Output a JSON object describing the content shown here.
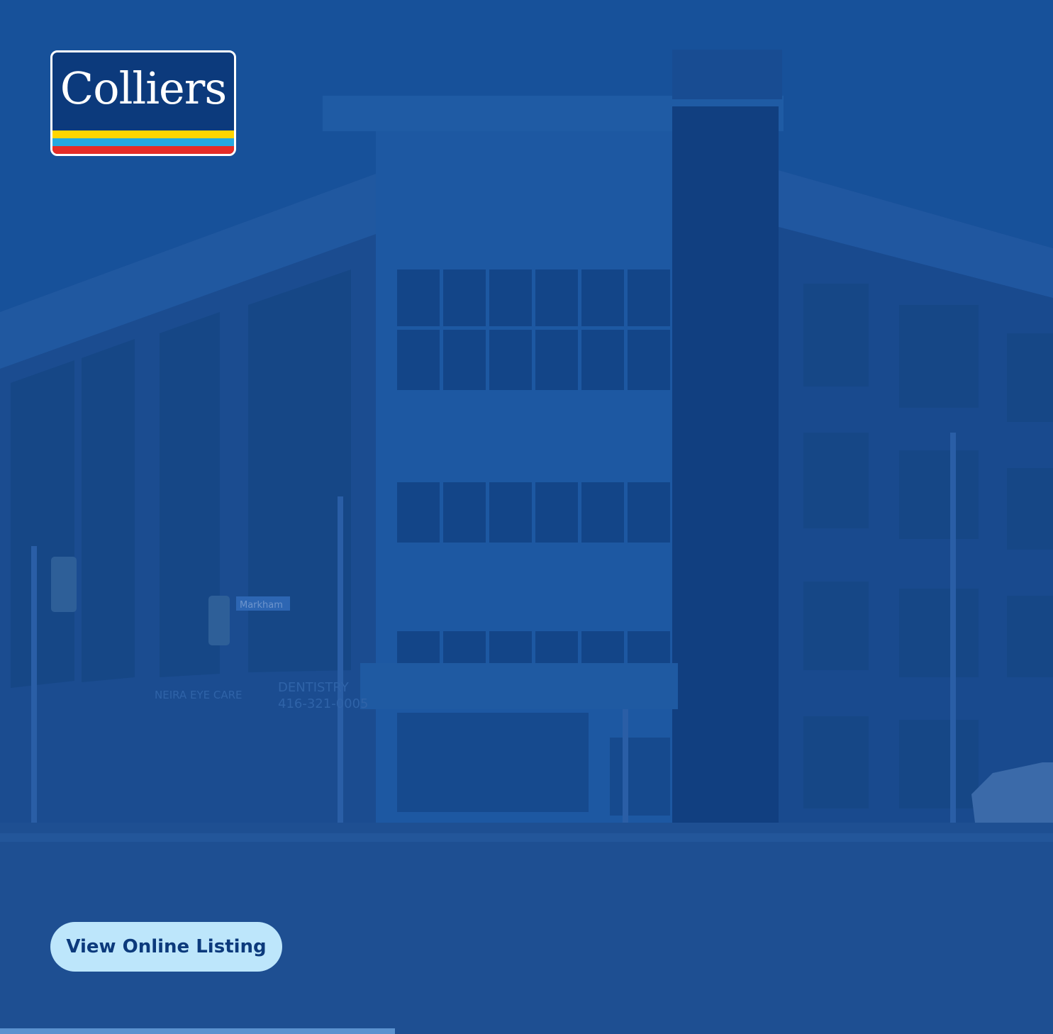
{
  "logo": {
    "text": "Colliers",
    "colors": {
      "background": "#0c3a7c",
      "yellow": "#ffd500",
      "blue": "#25a9e0",
      "red": "#e52d27"
    }
  },
  "background_photo": {
    "signs": {
      "street": "Markham",
      "eye_care": "NEIRA EYE CARE",
      "dentistry": "DENTISTRY",
      "phone": "416-321-0005"
    }
  },
  "cta": {
    "label": "View Online Listing"
  },
  "progress": {
    "fraction": 0.375
  },
  "colors": {
    "page_background": "#1a4f96",
    "cta_background": "#bde6fb",
    "cta_text": "#0c3a7c"
  }
}
